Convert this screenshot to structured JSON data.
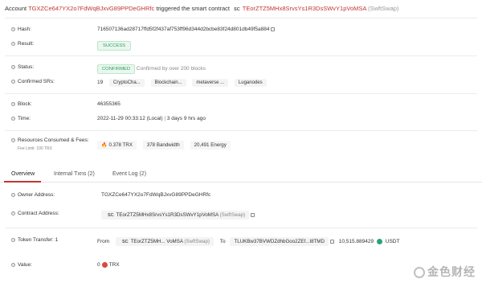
{
  "header": {
    "prefix": "Account",
    "account": "TGXZCe647YX2o7FdWqBJxvG89PPDeGHRfc",
    "action": "triggered the smart contract",
    "sc_label": "SC",
    "contract": "TEorZTZ5MHx8SrvsYs1R3DsSWvY1pVoMSA",
    "contract_tag": "(SwftSwap)"
  },
  "fields": {
    "hash": {
      "label": "Hash:",
      "value": "716507136ad28717ffd5f2f437af753ff96d344d2bcbe83f24d801db49f5a884"
    },
    "result": {
      "label": "Result:",
      "value": "SUCCESS"
    },
    "status": {
      "label": "Status:",
      "value": "CONFIRMED",
      "note": "Confirmed by over 200 blocks"
    },
    "confirmed_srs": {
      "label": "Confirmed SRs:",
      "count": "19",
      "srs": [
        "CryptoCha...",
        "Blockchain...",
        "metaverse ...",
        "Luganodes"
      ]
    },
    "block": {
      "label": "Block:",
      "value": "46355365"
    },
    "time": {
      "label": "Time:",
      "value": "2022-11-29 00:33:12 (Local)",
      "relative": "3 days 9 hrs ago"
    },
    "resources": {
      "label": "Resources Consumed & Fees:",
      "fee_limit": "Fee Limit: 100 TRX",
      "trx_amount": "0.378",
      "trx_unit": "TRX",
      "bandwidth": "378",
      "bandwidth_unit": "Bandwidth",
      "energy": "20,491",
      "energy_unit": "Energy"
    }
  },
  "tabs": [
    {
      "label": "Overview",
      "active": true
    },
    {
      "label": "Internal Txns (2)",
      "active": false
    },
    {
      "label": "Event Log (2)",
      "active": false
    }
  ],
  "overview": {
    "owner": {
      "label": "Owner Address:",
      "value": "TGXZCe647YX2o7FdWqBJxvG89PPDeGHRfc"
    },
    "contract": {
      "label": "Contract Address:",
      "sc": "SC",
      "value": "TEorZTZ5MHx8SrvsYs1R3DsSWvY1pVoMSA",
      "tag": "(SwftSwap)"
    },
    "token_transfer": {
      "label": "Token Transfer:",
      "count": "1",
      "from_label": "From",
      "from_sc": "SC",
      "from_value": "TEorZTZ5MH... VoMSA",
      "from_tag": "(SwftSwap)",
      "to_label": "To",
      "to_value": "TLUKBw37BVWDZdhbGoo2ZEf...I8TMD",
      "amount": "10,515.889429",
      "token": "USDT"
    },
    "value": {
      "label": "Value:",
      "amount": "0",
      "unit": "TRX"
    }
  },
  "watermark": "金色财经"
}
